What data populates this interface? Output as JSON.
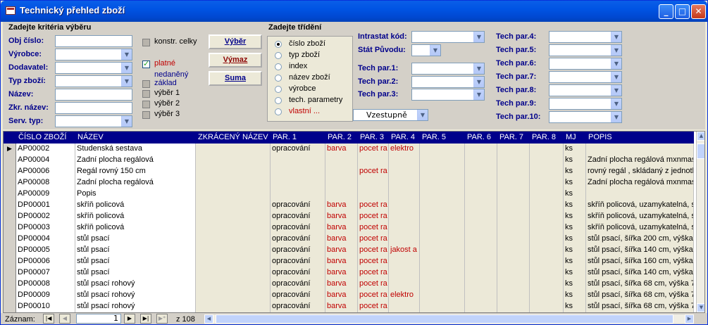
{
  "window": {
    "title": "Technický přehled zboží",
    "min": "_",
    "max": "□",
    "close": "✕"
  },
  "form": {
    "criteria_title": "Zadejte kritéria výběru",
    "labels": {
      "obj": "Obj číslo:",
      "vyrobce": "Výrobce:",
      "dodavatel": "Dodavatel:",
      "typ": "Typ zboží:",
      "nazev": "Název:",
      "zkr": "Zkr. název:",
      "serv": "Serv. typ:"
    },
    "checks": {
      "konstr": "konstr. celky",
      "platne": "platné",
      "nedaneny": "nedaněný",
      "zaklad": "základ",
      "v1": "výběr 1",
      "v2": "výběr 2",
      "v3": "výběr 3"
    },
    "buttons": {
      "vyber": "Výběr",
      "vymaz": "Výmaz",
      "suma": "Suma"
    },
    "sort_title": "Zadejte třídění",
    "sort_options": [
      "číslo zboží",
      "typ zboží",
      "index",
      "název zboží",
      "výrobce",
      "tech. parametry",
      "vlastní ..."
    ],
    "sort_dir": "Vzestupně",
    "intrastat": "Intrastat kód:",
    "stat": "Stát Původu:",
    "tech_left": [
      "Tech par.1:",
      "Tech par.2:",
      "Tech par.3:"
    ],
    "tech_right": [
      "Tech par.4:",
      "Tech par.5:",
      "Tech par.6:",
      "Tech par.7:",
      "Tech par.8:",
      "Tech par.9:",
      "Tech par.10:"
    ]
  },
  "grid": {
    "headers": [
      "ČÍSLO ZBOŽÍ",
      "NÁZEV",
      "ZKRÁCENÝ NÁZEV",
      "PAR. 1",
      "PAR. 2",
      "PAR. 3",
      "PAR. 4",
      "PAR. 5",
      "PAR. 6",
      "PAR. 7",
      "PAR. 8",
      "MJ",
      "POPIS"
    ],
    "rows": [
      [
        "AP00002",
        "Studenská sestava",
        "",
        "opracování",
        "barva",
        "pocet ra",
        "elektro",
        "",
        "",
        "",
        "",
        "ks",
        ""
      ],
      [
        "AP00004",
        "Zadní plocha regálová",
        "",
        "",
        "",
        "",
        "",
        "",
        "",
        "",
        "",
        "ks",
        "Zadní plocha regálová mxnmas"
      ],
      [
        "AP00006",
        "Regál rovný 150 cm",
        "",
        "",
        "",
        "pocet ra",
        "",
        "",
        "",
        "",
        "",
        "ks",
        "rovný regál , skládaný z jednotli"
      ],
      [
        "AP00008",
        "Zadní plocha regálová",
        "",
        "",
        "",
        "",
        "",
        "",
        "",
        "",
        "",
        "ks",
        "Zadní plocha regálová mxnmas"
      ],
      [
        "AP00009",
        "Popis",
        "",
        "",
        "",
        "",
        "",
        "",
        "",
        "",
        "",
        "ks",
        ""
      ],
      [
        "DP00001",
        "skříň policová",
        "",
        "opracování",
        "barva",
        "pocet ra",
        "",
        "",
        "",
        "",
        "",
        "ks",
        "skříň policová, uzamykatelná, s"
      ],
      [
        "DP00002",
        "skříň policová",
        "",
        "opracování",
        "barva",
        "pocet ra",
        "",
        "",
        "",
        "",
        "",
        "ks",
        "skříň policová, uzamykatelná, s"
      ],
      [
        "DP00003",
        "skříň policová",
        "",
        "opracování",
        "barva",
        "pocet ra",
        "",
        "",
        "",
        "",
        "",
        "ks",
        "skříň policová, uzamykatelná, s"
      ],
      [
        "DP00004",
        "stůl psací",
        "",
        "opracování",
        "barva",
        "pocet ra",
        "",
        "",
        "",
        "",
        "",
        "ks",
        "stůl psací, šířka 200 cm, výška"
      ],
      [
        "DP00005",
        "stůl psací",
        "",
        "opracování",
        "barva",
        "pocet ra",
        "jakost a",
        "",
        "",
        "",
        "",
        "ks",
        "stůl psací, šířka 140 cm, výška"
      ],
      [
        "DP00006",
        "stůl psací",
        "",
        "opracování",
        "barva",
        "pocet ra",
        "",
        "",
        "",
        "",
        "",
        "ks",
        "stůl psací, šířka 160 cm, výška"
      ],
      [
        "DP00007",
        "stůl psací",
        "",
        "opracování",
        "barva",
        "pocet ra",
        "",
        "",
        "",
        "",
        "",
        "ks",
        "stůl psací, šířka 140 cm, výška"
      ],
      [
        "DP00008",
        "stůl psací rohový",
        "",
        "opracování",
        "barva",
        "pocet ra",
        "",
        "",
        "",
        "",
        "",
        "ks",
        "stůl psací, šířka 68 cm, výška 7"
      ],
      [
        "DP00009",
        "stůl psací rohový",
        "",
        "opracování",
        "barva",
        "pocet ra",
        "elektro",
        "",
        "",
        "",
        "",
        "ks",
        "stůl psací, šířka 68 cm, výška 7"
      ],
      [
        "DP00010",
        "stůl psací rohový",
        "",
        "opracování",
        "barva",
        "pocet ra",
        "",
        "",
        "",
        "",
        "",
        "ks",
        "stůl psací, šířka 68 cm, výška 7"
      ]
    ]
  },
  "nav": {
    "label": "Záznam:",
    "current": "1",
    "total": "z 108"
  }
}
